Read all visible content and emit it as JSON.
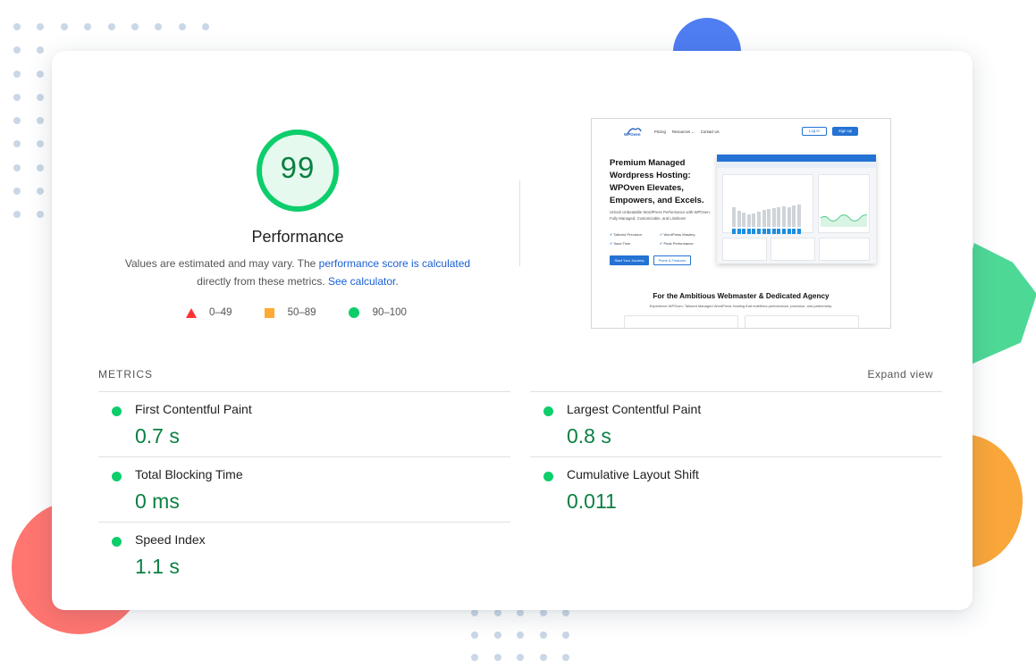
{
  "score": {
    "value": "99",
    "fraction": 0.99,
    "title": "Performance",
    "desc_prefix": "Values are estimated and may vary. The ",
    "desc_link1": "performance score is calculated",
    "desc_middle": " directly from these metrics. ",
    "desc_link2": "See calculator",
    "desc_suffix": "."
  },
  "legend": [
    {
      "range": "0–49",
      "shape": "triangle",
      "color": "#ff3333"
    },
    {
      "range": "50–89",
      "shape": "square",
      "color": "#ffaa33"
    },
    {
      "range": "90–100",
      "shape": "circle",
      "color": "#0cce6b"
    }
  ],
  "thumbnail": {
    "logo": "WPOven",
    "nav": [
      "Pricing",
      "Resources ⌄",
      "Contact Us"
    ],
    "login": "Log In",
    "signup": "Sign Up",
    "hero": "Premium Managed Wordpress Hosting: WPOven Elevates, Empowers, and Excels.",
    "sub": "Unlock Unbeatable WordPress Performance with WPOven: Fully Managed, Customizable, and Limitless!",
    "checks": [
      "Tailored Precision",
      "WordPress Mastery",
      "Save Time",
      "Peak Performance"
    ],
    "cta1": "Start Your Journey",
    "cta2": "Plans & Features",
    "section_title": "For the Ambitious Webmaster & Dedicated Agency",
    "section_sub": "Experience WPOven: Tailored Managed WordPress Hosting that redefines performance, precision, and partnership."
  },
  "metrics_section": {
    "header": "METRICS",
    "expand": "Expand view"
  },
  "metrics": [
    {
      "name": "First Contentful Paint",
      "value": "0.7 s"
    },
    {
      "name": "Largest Contentful Paint",
      "value": "0.8 s"
    },
    {
      "name": "Total Blocking Time",
      "value": "0 ms"
    },
    {
      "name": "Cumulative Layout Shift",
      "value": "0.011"
    },
    {
      "name": "Speed Index",
      "value": "1.1 s"
    }
  ],
  "colors": {
    "good": "#0cce6b",
    "good_text": "#0b8043",
    "link": "#1a5fd2"
  }
}
